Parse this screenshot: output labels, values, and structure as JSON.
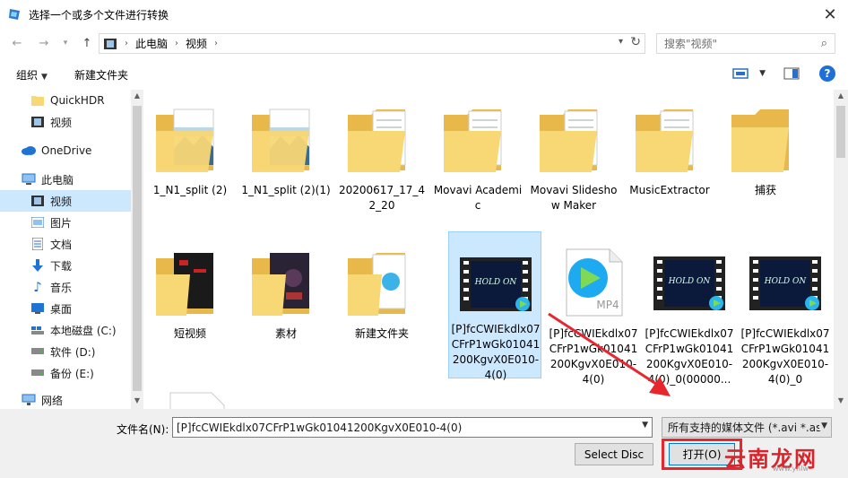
{
  "window": {
    "title": "选择一个或多个文件进行转换"
  },
  "nav": {
    "breadcrumbs": [
      "此电脑",
      "视频"
    ],
    "search_placeholder": "搜索\"视频\""
  },
  "toolbar": {
    "organize": "组织",
    "new_folder": "新建文件夹"
  },
  "sidebar": {
    "items": [
      {
        "label": "QuickHDR",
        "icon": "folder-icon"
      },
      {
        "label": "视频",
        "icon": "video-icon"
      },
      {
        "label": "OneDrive",
        "icon": "cloud-icon"
      },
      {
        "label": "此电脑",
        "icon": "computer-icon"
      },
      {
        "label": "视频",
        "icon": "video-icon"
      },
      {
        "label": "图片",
        "icon": "pictures-icon"
      },
      {
        "label": "文档",
        "icon": "document-icon"
      },
      {
        "label": "下载",
        "icon": "download-icon"
      },
      {
        "label": "音乐",
        "icon": "music-icon"
      },
      {
        "label": "桌面",
        "icon": "desktop-icon"
      },
      {
        "label": "本地磁盘 (C:)",
        "icon": "drive-c-icon"
      },
      {
        "label": "软件 (D:)",
        "icon": "drive-icon"
      },
      {
        "label": "备份 (E:)",
        "icon": "drive-icon"
      },
      {
        "label": "网络",
        "icon": "network-icon"
      }
    ]
  },
  "files": [
    {
      "label": "1_N1_split (2)",
      "kind": "folder-doc"
    },
    {
      "label": "1_N1_split (2)(1)",
      "kind": "folder-doc"
    },
    {
      "label": "20200617_17_42_20",
      "kind": "folder-doc"
    },
    {
      "label": "Movavi Academic",
      "kind": "folder-doc"
    },
    {
      "label": "Movavi Slideshow Maker",
      "kind": "folder-doc"
    },
    {
      "label": "MusicExtractor",
      "kind": "folder-doc"
    },
    {
      "label": "捕获",
      "kind": "folder"
    },
    {
      "label": "短视频",
      "kind": "folder-video"
    },
    {
      "label": "素材",
      "kind": "folder-video"
    },
    {
      "label": "新建文件夹",
      "kind": "folder-doc"
    },
    {
      "label": "[P]fcCWIEkdlx07CFrP1wGk01041200KgvX0E010-4(0)",
      "kind": "video",
      "selected": true
    },
    {
      "label": "[P]fcCWIEkdlx07CFrP1wGk01041200KgvX0E010-4(0)",
      "kind": "mp4"
    },
    {
      "label": "[P]fcCWIEkdlx07CFrP1wGk01041200KgvX0E010-4(0)_0(00000...",
      "kind": "video"
    },
    {
      "label": "[P]fcCWIEkdlx07CFrP1wGk01041200KgvX0E010-4(0)_0",
      "kind": "video"
    }
  ],
  "bottom": {
    "filename_label": "文件名(N):",
    "filename_value": "[P]fcCWIEkdlx07CFrP1wGk01041200KgvX0E010-4(0)",
    "filter_value": "所有支持的媒体文件 (*.avi *.as",
    "select_disc": "Select Disc",
    "open": "打开(O)"
  },
  "watermark": {
    "text": "云南龙网",
    "sub": "www.ynlw"
  },
  "colors": {
    "selection": "#cce8ff",
    "highlight_red": "#e8262d",
    "folder": "#f8d775"
  }
}
